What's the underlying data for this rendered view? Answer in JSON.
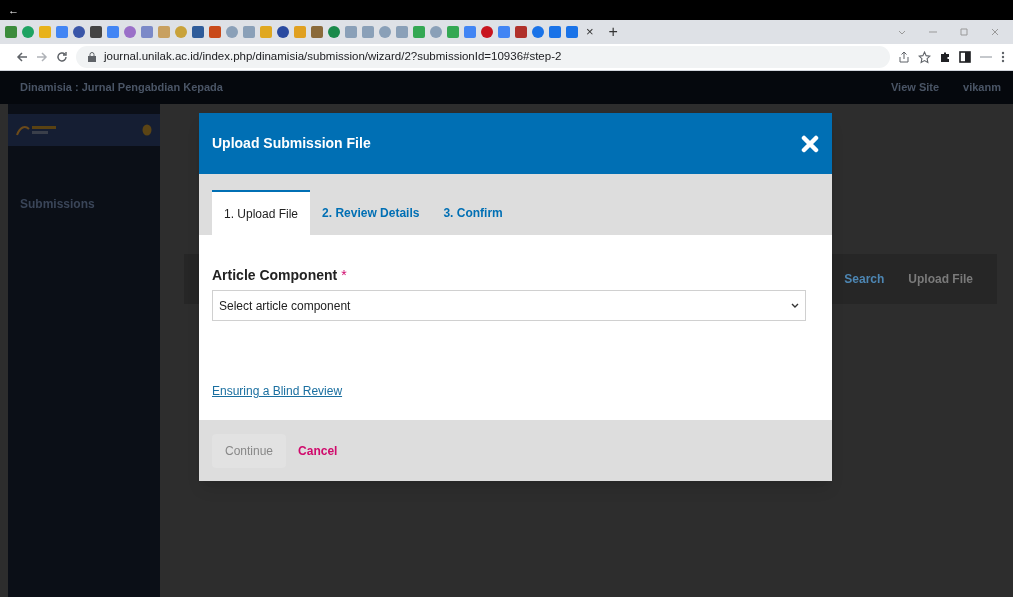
{
  "browser": {
    "back_glyph": "←",
    "tab_close": "×",
    "new_tab": "+",
    "url": "journal.unilak.ac.id/index.php/dinamisia/submission/wizard/2?submissionId=10936#step-2"
  },
  "site_header": {
    "title": "Dinamisia : Jurnal Pengabdian Kepada",
    "links": [
      "View Site",
      "vikanm"
    ]
  },
  "sidebar": {
    "items": [
      {
        "label": "Submissions"
      }
    ]
  },
  "page_actions": [
    "Search",
    "Upload File"
  ],
  "modal": {
    "title": "Upload Submission File",
    "tabs": [
      {
        "label": "1. Upload File",
        "selected": true
      },
      {
        "label": "2. Review Details",
        "selected": false
      },
      {
        "label": "3. Confirm",
        "selected": false
      }
    ],
    "field": {
      "label": "Article Component",
      "required_mark": "*",
      "placeholder": "Select article component"
    },
    "link": "Ensuring a Blind Review",
    "buttons": [
      {
        "label": "Continue",
        "kind": "button",
        "disabled": true
      },
      {
        "label": "Cancel",
        "kind": "link",
        "disabled": false
      }
    ]
  }
}
